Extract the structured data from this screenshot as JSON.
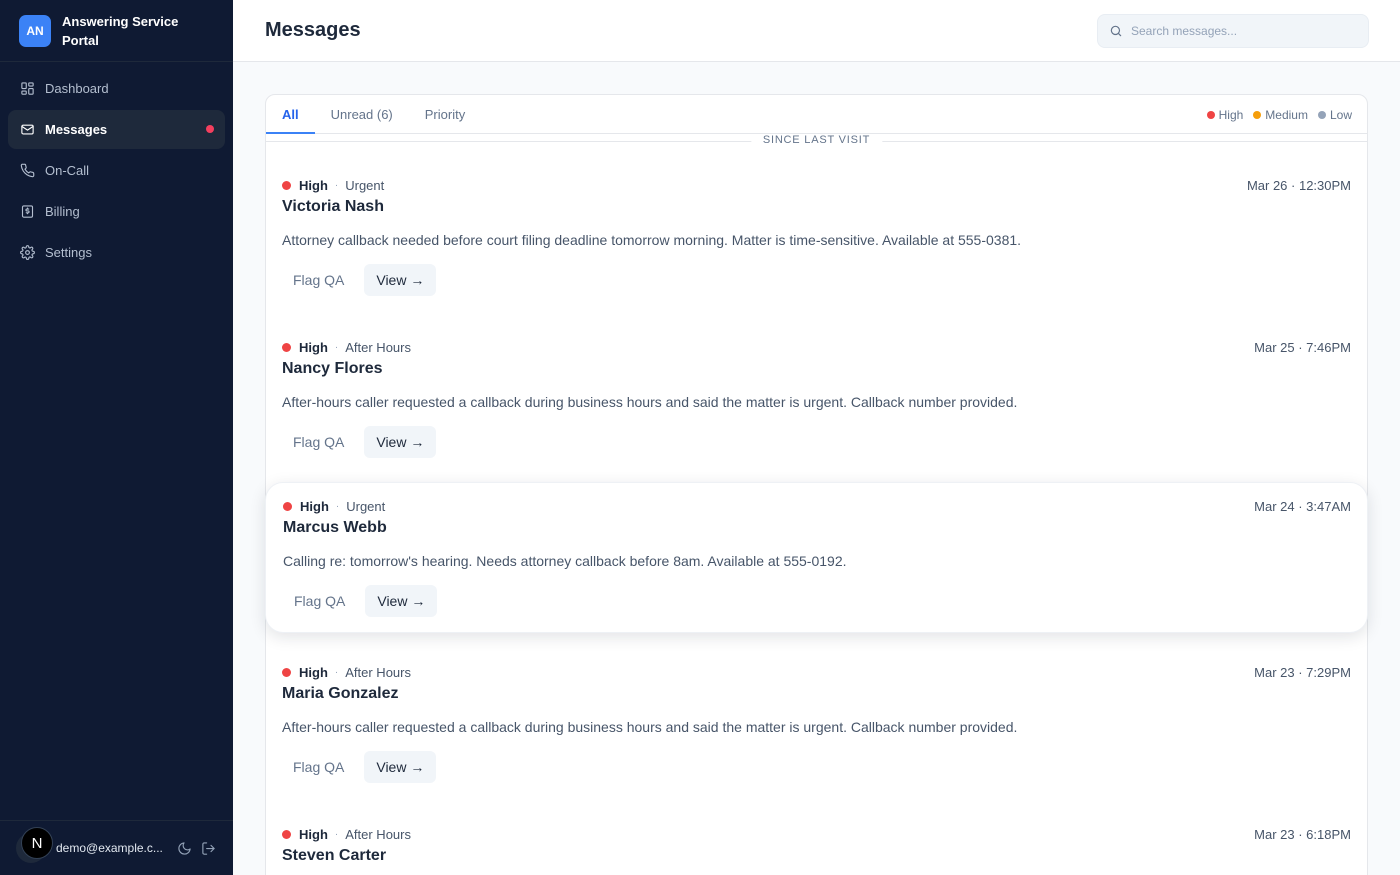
{
  "sidebar": {
    "brand_initials": "AN",
    "brand_title_line1": "Answering Service",
    "brand_title_line2": "Portal",
    "items": [
      {
        "label": "Dashboard",
        "icon": "dashboard-icon"
      },
      {
        "label": "Messages",
        "icon": "mail-icon",
        "active": true,
        "unread_dot": true
      },
      {
        "label": "On-Call",
        "icon": "phone-icon"
      },
      {
        "label": "Billing",
        "icon": "receipt-icon"
      },
      {
        "label": "Settings",
        "icon": "gear-icon"
      }
    ],
    "user": {
      "badge": "N",
      "email": "demo@example.c..."
    }
  },
  "header": {
    "title": "Messages",
    "search_placeholder": "Search messages..."
  },
  "tabs": [
    {
      "label": "All",
      "active": true
    },
    {
      "label": "Unread (6)"
    },
    {
      "label": "Priority"
    }
  ],
  "legend": [
    {
      "label": "High",
      "color": "#ef4444"
    },
    {
      "label": "Medium",
      "color": "#f59e0b"
    },
    {
      "label": "Low",
      "color": "#94a3b8"
    }
  ],
  "divider_label": "SINCE LAST VISIT",
  "action_labels": {
    "flag": "Flag QA",
    "view": "View →"
  },
  "meta_separator": "·",
  "messages": [
    {
      "priority": "High",
      "category": "Urgent",
      "name": "Victoria Nash",
      "date": "Mar 26 · 12:30PM",
      "body": "Attorney callback needed before court filing deadline tomorrow morning. Matter is time-sensitive. Available at 555-0381."
    },
    {
      "priority": "High",
      "category": "After Hours",
      "name": "Nancy Flores",
      "date": "Mar 25 · 7:46PM",
      "body": "After-hours caller requested a callback during business hours and said the matter is urgent. Callback number provided."
    },
    {
      "priority": "High",
      "category": "Urgent",
      "name": "Marcus Webb",
      "date": "Mar 24 · 3:47AM",
      "body": "Calling re: tomorrow's hearing. Needs attorney callback before 8am. Available at 555-0192."
    },
    {
      "priority": "High",
      "category": "After Hours",
      "name": "Maria Gonzalez",
      "date": "Mar 23 · 7:29PM",
      "body": "After-hours caller requested a callback during business hours and said the matter is urgent. Callback number provided."
    },
    {
      "priority": "High",
      "category": "After Hours",
      "name": "Steven Carter",
      "date": "Mar 23 · 6:18PM",
      "body": ""
    }
  ],
  "colors": {
    "sidebar_bg": "#0f1a33",
    "accent": "#3b82f6",
    "high": "#ef4444",
    "medium": "#f59e0b",
    "low": "#94a3b8"
  }
}
